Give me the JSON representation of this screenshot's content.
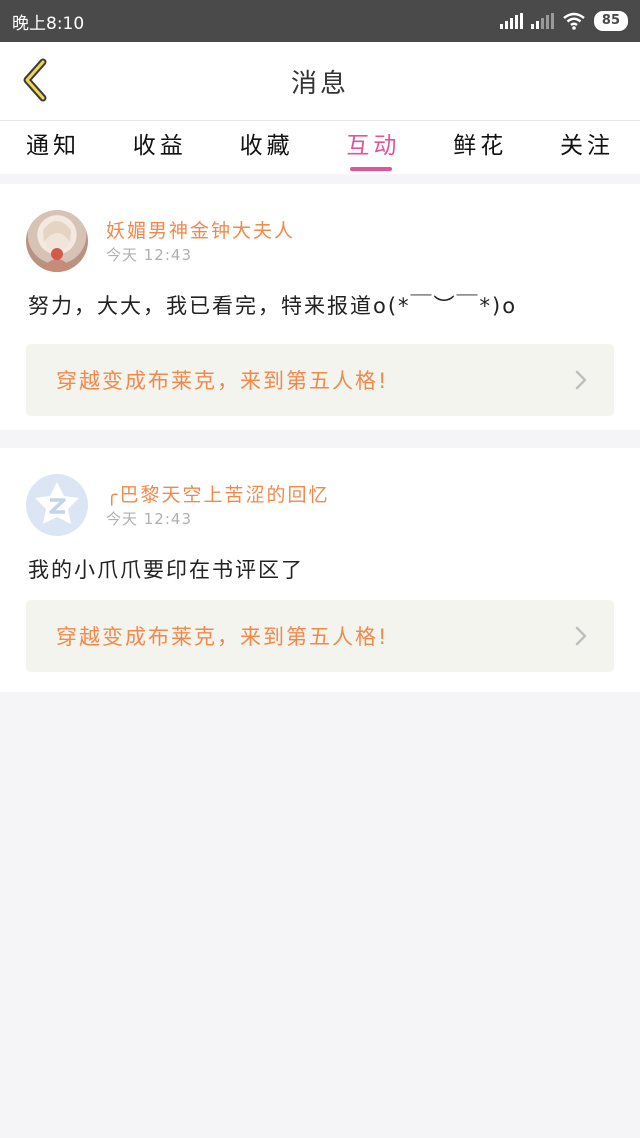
{
  "status": {
    "time": "晚上8:10",
    "battery": "85"
  },
  "header": {
    "title": "消息"
  },
  "tabs": [
    {
      "label": "通知"
    },
    {
      "label": "收益"
    },
    {
      "label": "收藏"
    },
    {
      "label": "互动"
    },
    {
      "label": "鲜花"
    },
    {
      "label": "关注"
    }
  ],
  "active_tab": "互动",
  "messages": [
    {
      "user": "妖媚男神金钟大夫人",
      "time": "今天 12:43",
      "content": "努力，大大，我已看完，特来报道o(*￣︶￣*)o",
      "book": "穿越变成布莱克，来到第五人格!"
    },
    {
      "user": "╭巴黎天空上苦涩的回忆",
      "time": "今天 12:43",
      "content": "我的小爪爪要印在书评区了",
      "book": "穿越变成布莱克，来到第五人格!"
    }
  ],
  "colors": {
    "accent": "#e0559a",
    "name": "#f08a4b",
    "status_bar": "#4a4a4a"
  }
}
